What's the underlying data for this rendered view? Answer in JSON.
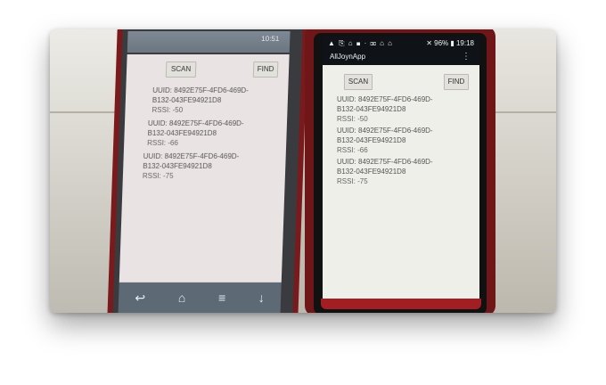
{
  "left_phone": {
    "title": "",
    "status": "10:51",
    "buttons": {
      "scan": "SCAN",
      "find": "FIND"
    },
    "entries": [
      {
        "uuid_line1": "UUID: 8492E75F-4FD6-469D-",
        "uuid_line2": "B132-043FE94921D8",
        "rssi": "RSSI: -50"
      },
      {
        "uuid_line1": "UUID: 8492E75F-4FD6-469D-",
        "uuid_line2": "B132-043FE94921D8",
        "rssi": "RSSI: -66"
      },
      {
        "uuid_line1": "UUID: 8492E75F-4FD6-469D-",
        "uuid_line2": "B132-043FE94921D8",
        "rssi": "RSSI: -75"
      }
    ],
    "nav": {
      "back": "↩",
      "home": "⌂",
      "menu": "≡",
      "down": "↓"
    }
  },
  "right_phone": {
    "status_left": "▲ ⎘ ⌂ ◼ · ⌧ ⌂ ⌂",
    "status_right": "✕ 96% ▮ 19:18",
    "app_title": "AllJoynApp",
    "menu_icon": "⋮",
    "buttons": {
      "scan": "SCAN",
      "find": "FIND"
    },
    "entries": [
      {
        "uuid_line1": "UUID: 8492E75F-4FD6-469D-",
        "uuid_line2": "B132-043FE94921D8",
        "rssi": "RSSI: -50"
      },
      {
        "uuid_line1": "UUID: 8492E75F-4FD6-469D-",
        "uuid_line2": "B132-043FE94921D8",
        "rssi": "RSSI: -66"
      },
      {
        "uuid_line1": "UUID: 8492E75F-4FD6-469D-",
        "uuid_line2": "B132-043FE94921D8",
        "rssi": "RSSI: -75"
      }
    ]
  }
}
